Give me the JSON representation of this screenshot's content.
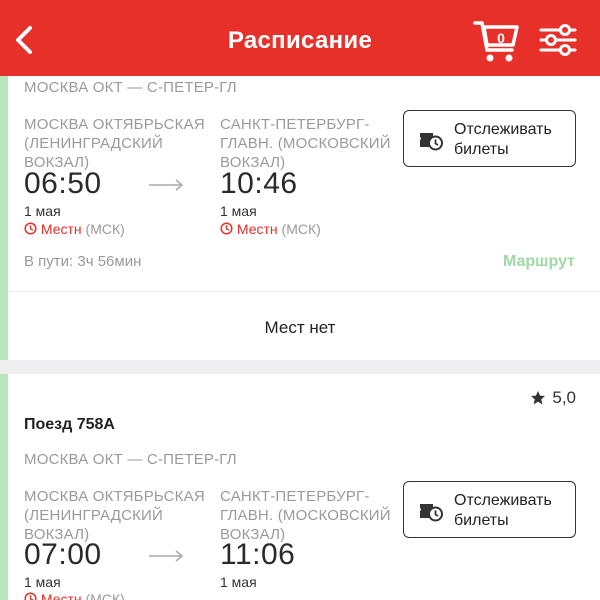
{
  "header": {
    "title": "Расписание",
    "cart_count": "0",
    "accent_color": "#e7302a"
  },
  "trains": [
    {
      "route": "МОСКВА ОКТ — С-ПЕТЕР-ГЛ",
      "departure": {
        "station": [
          "МОСКВА ОКТЯБРЬСКАЯ",
          "(ЛЕНИНГРАДСКИЙ",
          "ВОКЗАЛ)"
        ],
        "time": "06:50",
        "date": "1 мая",
        "tz_label": "Местн",
        "tz_zone": "(МСК)"
      },
      "arrival": {
        "station": [
          "САНКТ-ПЕТЕРБУРГ-",
          "ГЛАВН. (МОСКОВСКИЙ",
          "ВОКЗАЛ)"
        ],
        "time": "10:46",
        "date": "1 мая",
        "tz_label": "Местн",
        "tz_zone": "(МСК)"
      },
      "track_button": [
        "Отслеживать",
        "билеты"
      ],
      "travel_time": "В пути: 3ч 56мин",
      "route_link": "Маршрут",
      "seats_status": "Мест нет"
    },
    {
      "rating": "5,0",
      "train_name": "Поезд 758А",
      "route": "МОСКВА ОКТ — С-ПЕТЕР-ГЛ",
      "departure": {
        "station": [
          "МОСКВА ОКТЯБРЬСКАЯ",
          "(ЛЕНИНГРАДСКИЙ",
          "ВОКЗАЛ)"
        ],
        "time": "07:00",
        "date": "1 мая",
        "tz_label": "Местн",
        "tz_zone": "(МСК)"
      },
      "arrival": {
        "station": [
          "САНКТ-ПЕТЕРБУРГ-",
          "ГЛАВН. (МОСКОВСКИЙ",
          "ВОКЗАЛ)"
        ],
        "time": "11:06",
        "date": "1 мая"
      },
      "track_button": [
        "Отслеживать",
        "билеты"
      ]
    }
  ]
}
